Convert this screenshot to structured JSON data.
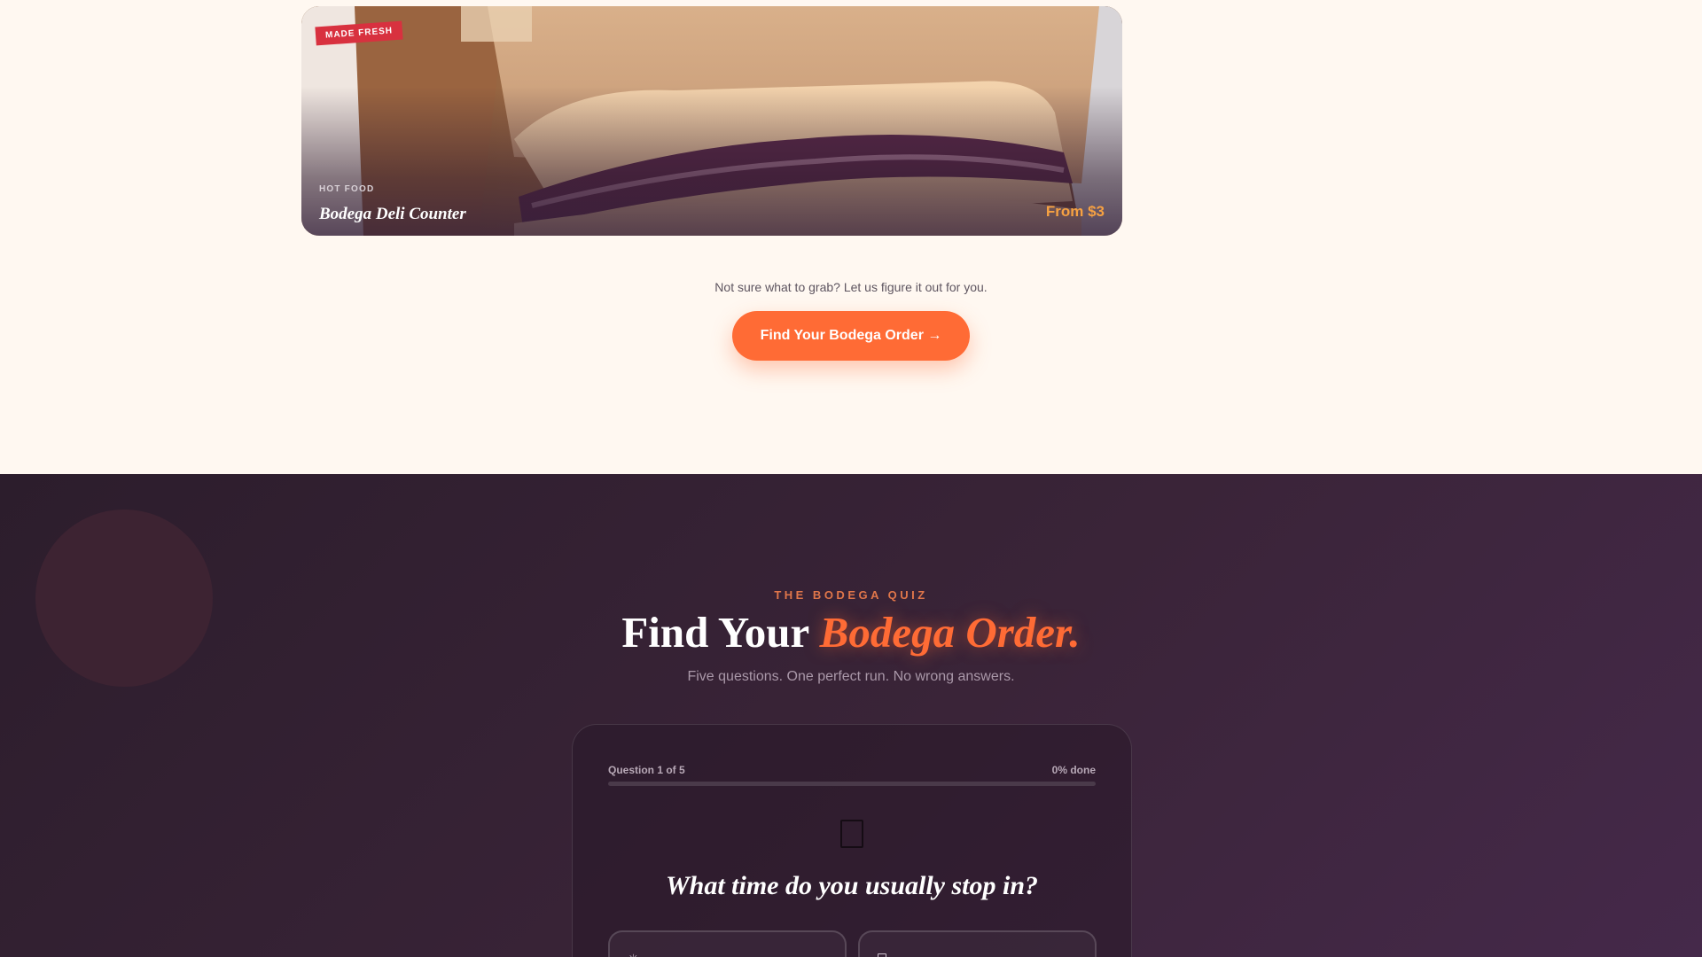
{
  "featured_card": {
    "badge": "MADE FRESH",
    "kicker": "HOT FOOD",
    "title": "Bodega Deli Counter",
    "price": "From $3",
    "image": "sandwich-photo"
  },
  "cta": {
    "prompt": "Not sure what to grab? Let us figure it out for you.",
    "button_label": "Find Your Bodega Order →"
  },
  "quiz": {
    "eyebrow": "THE BODEGA QUIZ",
    "title_plain": "Find Your ",
    "title_accent": "Bodega Order.",
    "subtitle": "Five questions. One perfect run. No wrong answers.",
    "progress_label": "Question 1 of 5",
    "progress_pct_label": "0% done",
    "progress_value": 0,
    "question_icon": "missing-glyph-icon",
    "question": "What time do you usually stop in?",
    "options": [
      {
        "icon": "sun-icon"
      },
      {
        "icon": "missing-glyph-icon"
      }
    ]
  },
  "colors": {
    "page_bg": "#fff8f1",
    "accent": "#ff6b35",
    "badge_red": "#d8313f",
    "price_orange": "#f6a142",
    "quiz_bg": "#3a2438"
  }
}
